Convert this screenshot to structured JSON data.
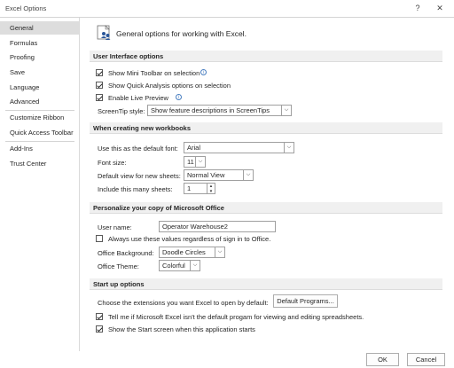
{
  "window": {
    "title": "Excel Options",
    "help": "?",
    "close": "✕"
  },
  "sidebar": {
    "items": [
      {
        "label": "General"
      },
      {
        "label": "Formulas"
      },
      {
        "label": "Proofing"
      },
      {
        "label": "Save"
      },
      {
        "label": "Language"
      },
      {
        "label": "Advanced"
      },
      {
        "label": "Customize Ribbon"
      },
      {
        "label": "Quick Access Toolbar"
      },
      {
        "label": "Add-Ins"
      },
      {
        "label": "Trust Center"
      }
    ],
    "active": "General"
  },
  "header": {
    "text": "General options for working with Excel."
  },
  "ui_options": {
    "heading": "User Interface options",
    "mini_toolbar": "Show Mini Toolbar on selection",
    "quick_analysis": "Show Quick Analysis options on selection",
    "live_preview": "Enable Live Preview",
    "screentip_label": "ScreenTip style:",
    "screentip_value": "Show feature descriptions in ScreenTips"
  },
  "new_workbooks": {
    "heading": "When creating new workbooks",
    "font_label": "Use this as the default font:",
    "font_value": "Arial",
    "size_label": "Font size:",
    "size_value": "11",
    "view_label": "Default view for new sheets:",
    "view_value": "Normal View",
    "sheets_label": "Include this many sheets:",
    "sheets_value": "1"
  },
  "personalize": {
    "heading": "Personalize your copy of Microsoft Office",
    "username_label": "User name:",
    "username_value": "Operator Warehouse2",
    "always_use": "Always use these values regardless of sign in to Office.",
    "background_label": "Office Background:",
    "background_value": "Doodle Circles",
    "theme_label": "Office Theme:",
    "theme_value": "Colorful"
  },
  "startup": {
    "heading": "Start up options",
    "extensions_label": "Choose the extensions you want Excel to open by default:",
    "default_programs": "Default Programs...",
    "tell_me": "Tell me if Microsoft Excel isn't the default progam for viewing and editing spreadsheets.",
    "show_start": "Show the Start screen when this application starts"
  },
  "footer": {
    "ok": "OK",
    "cancel": "Cancel"
  },
  "icons": {
    "info": "i",
    "dropdown": "⌵",
    "spin_up": "▲",
    "spin_down": "▼"
  }
}
